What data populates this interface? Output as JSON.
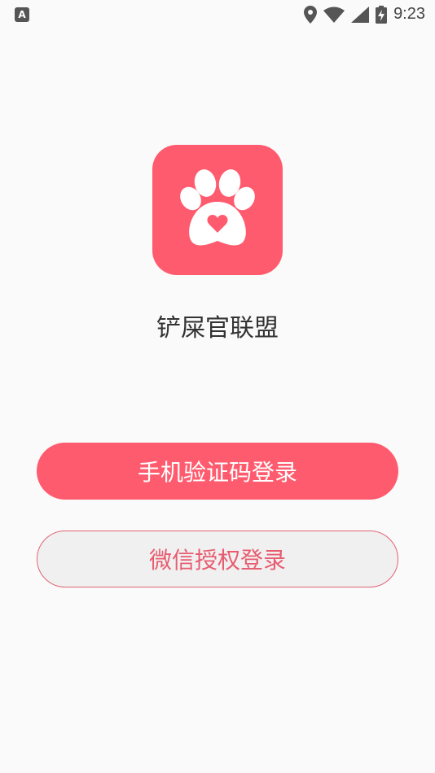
{
  "status_bar": {
    "left_icon_letter": "A",
    "time": "9:23",
    "icons": [
      "location-icon",
      "wifi-icon",
      "signal-icon",
      "battery-charging-icon"
    ]
  },
  "app": {
    "name": "铲屎官联盟",
    "logo_icon": "paw-heart-icon"
  },
  "buttons": {
    "phone_login": "手机验证码登录",
    "wechat_login": "微信授权登录"
  },
  "colors": {
    "primary": "#ff5b6e",
    "background": "#fafafa",
    "secondary_bg": "#f0f0f0",
    "secondary_text": "#e85c70"
  }
}
